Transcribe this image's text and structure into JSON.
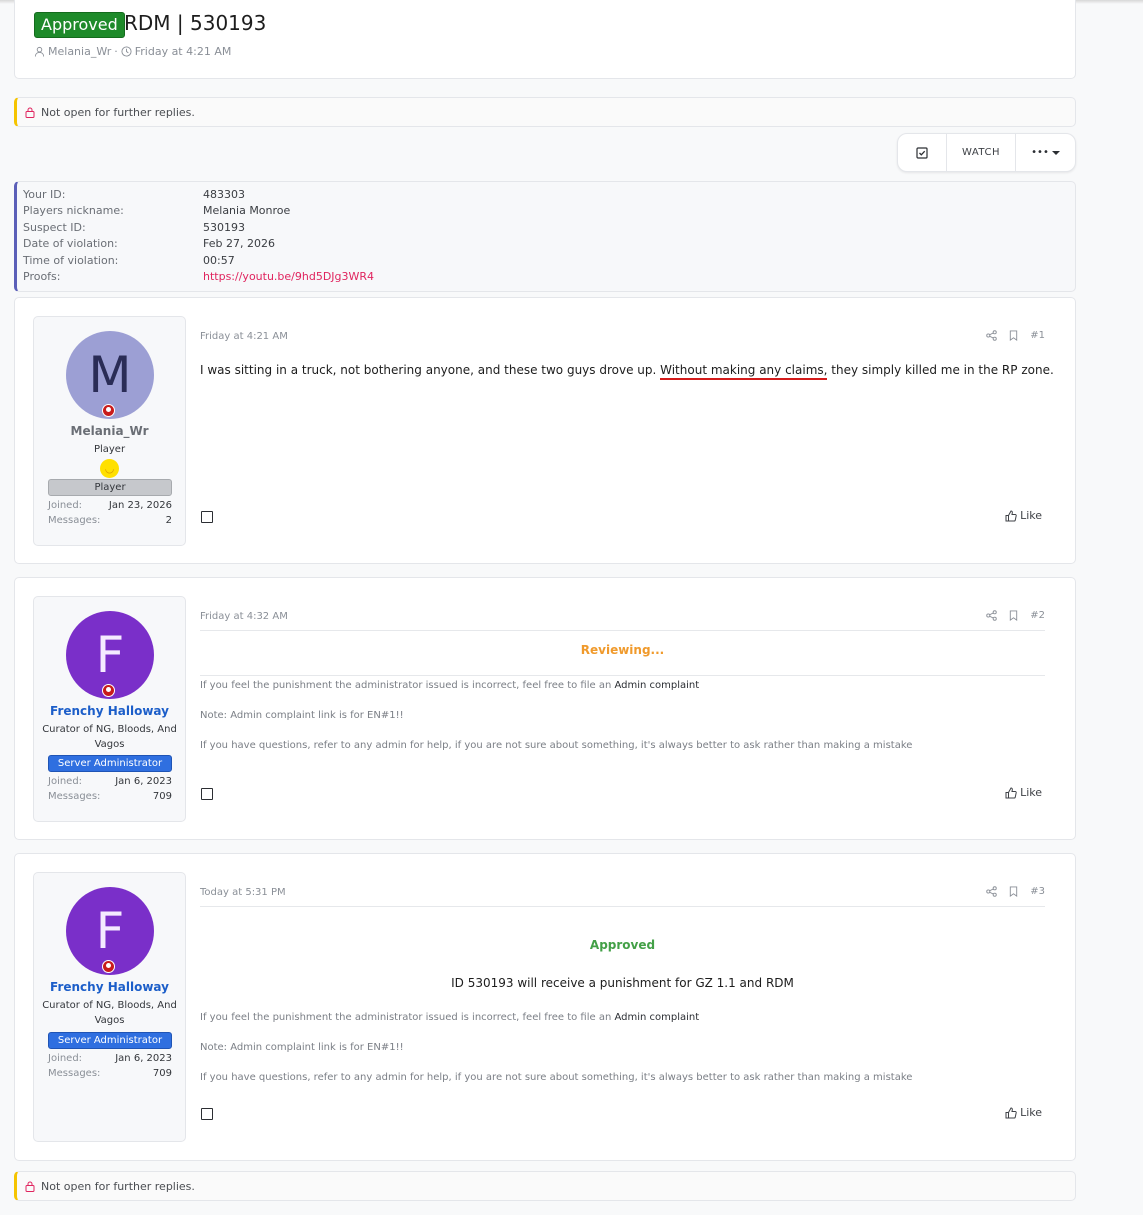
{
  "thread": {
    "prefix": "Approved",
    "title": "RDM | 530193",
    "author": "Melania_Wr",
    "meta_sep": "·",
    "date": "Friday at 4:21 AM"
  },
  "notice_text": "Not open for further replies.",
  "buttons": {
    "watch": "WATCH",
    "more": "•••"
  },
  "info": [
    {
      "label": "Your ID:",
      "value": "483303"
    },
    {
      "label": "Players nickname:",
      "value": "Melania Monroe"
    },
    {
      "label": "Suspect ID:",
      "value": "530193"
    },
    {
      "label": "Date of violation:",
      "value": "Feb 27, 2026"
    },
    {
      "label": "Time of violation:",
      "value": "00:57"
    },
    {
      "label": "Proofs:",
      "value": "https://youtu.be/9hd5DJg3WR4"
    }
  ],
  "posts": [
    {
      "user": {
        "initial": "M",
        "name": "Melania_Wr",
        "title": "Player",
        "banner": "Player",
        "joined_label": "Joined:",
        "joined": "Jan 23, 2026",
        "messages_label": "Messages:",
        "messages": "2"
      },
      "date": "Friday at 4:21 AM",
      "number": "#1",
      "text_before": "I was sitting in a truck, not bothering anyone, and these two guys drove up. ",
      "text_underlined": "Without making any claims,",
      "text_after": " they simply killed me in the RP zone.",
      "like": "Like"
    },
    {
      "user": {
        "initial": "F",
        "name": "Frenchy Halloway",
        "title": "Curator of NG, Bloods, And Vagos",
        "banner": "Server Administrator",
        "joined_label": "Joined:",
        "joined": "Jan 6, 2023",
        "messages_label": "Messages:",
        "messages": "709"
      },
      "date": "Friday at 4:32 AM",
      "number": "#2",
      "status": "Reviewing...",
      "line1": "If you feel the punishment the administrator issued is incorrect, feel free to file an ",
      "line1_link": "Admin complaint",
      "line2": "Note: Admin complaint link is for EN#1!!",
      "line3": "If you have questions, refer to any admin for help, if you are not sure about something, it's always better to ask rather than making a mistake",
      "like": "Like"
    },
    {
      "user": {
        "initial": "F",
        "name": "Frenchy Halloway",
        "title": "Curator of NG, Bloods, And Vagos",
        "banner": "Server Administrator",
        "joined_label": "Joined:",
        "joined": "Jan 6, 2023",
        "messages_label": "Messages:",
        "messages": "709"
      },
      "date": "Today at 5:31 PM",
      "number": "#3",
      "status": "Approved",
      "verdict": "ID 530193 will receive a punishment for GZ 1.1 and RDM",
      "line1": "If you feel the punishment the administrator issued is incorrect, feel free to file an ",
      "line1_link": "Admin complaint",
      "line2": "Note: Admin complaint link is for EN#1!!",
      "line3": "If you have questions, refer to any admin for help, if you are not sure about something, it's always better to ask rather than making a mistake",
      "like": "Like"
    }
  ]
}
